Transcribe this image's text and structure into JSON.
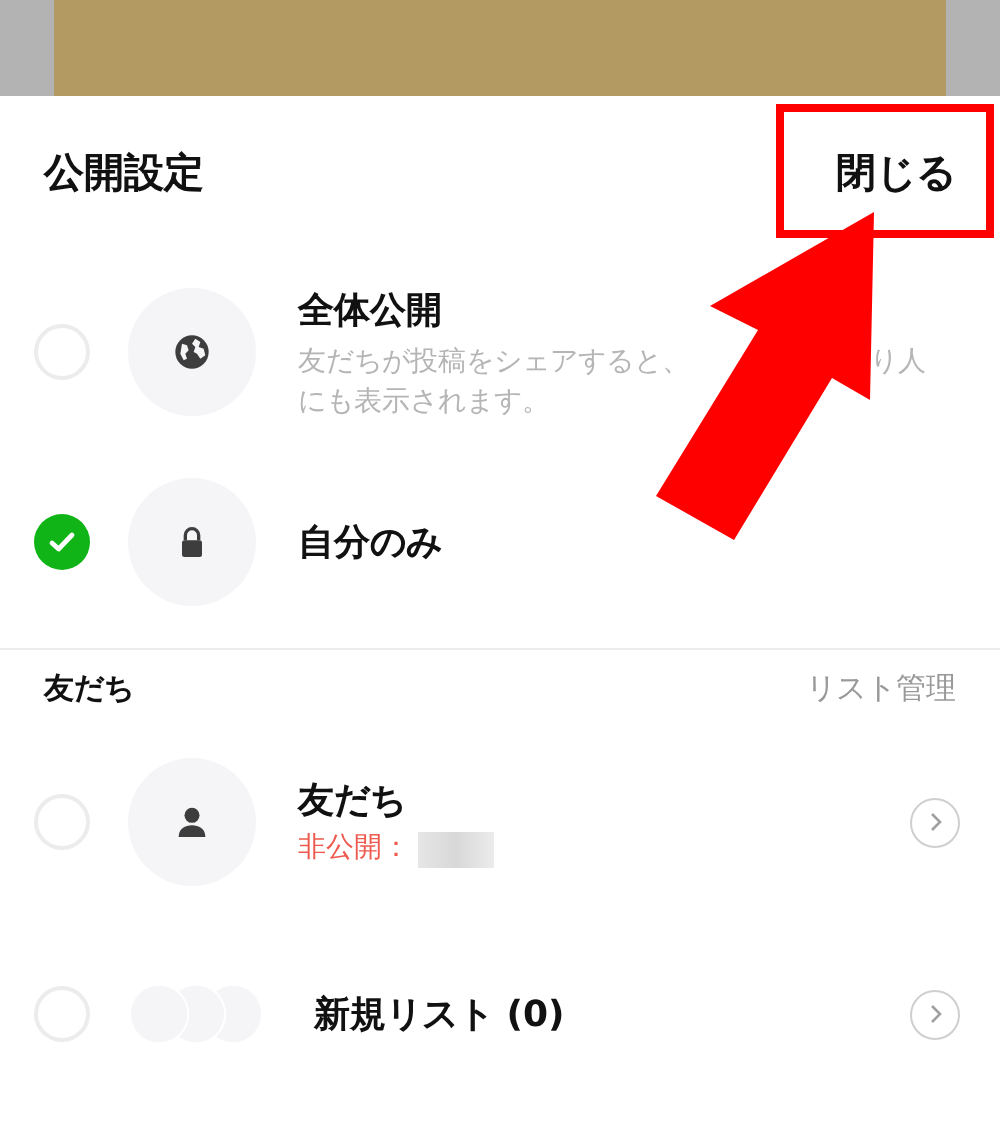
{
  "header": {
    "title": "公開設定",
    "close": "閉じる"
  },
  "options": [
    {
      "kind": "globe",
      "title": "全体公開",
      "description_parts": [
        "友だちが投稿をシェアすると、",
        "り人",
        "にも表示されます。"
      ],
      "selected": false
    },
    {
      "kind": "lock",
      "title": "自分のみ",
      "selected": true
    }
  ],
  "section": {
    "title": "友だち",
    "action": "リスト管理"
  },
  "lists": [
    {
      "kind": "person",
      "title": "友だち",
      "subtitle": "非公開：",
      "redacted": true,
      "selected": false
    },
    {
      "kind": "group",
      "title": "新規リスト (0)",
      "selected": false
    }
  ],
  "annotation": {
    "highlight_close": true,
    "arrow": true
  }
}
